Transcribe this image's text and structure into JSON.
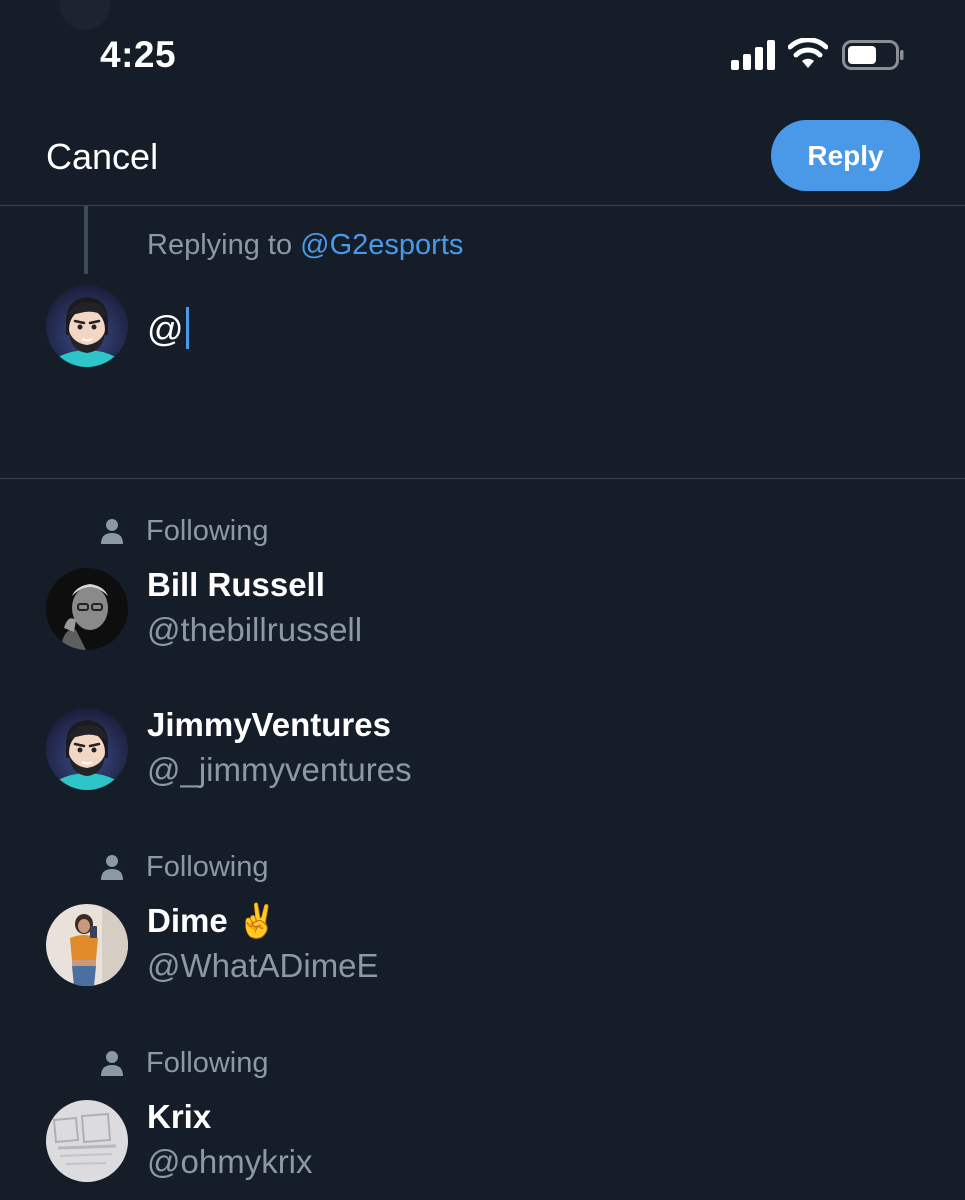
{
  "status_bar": {
    "time": "4:25",
    "icons": [
      "signal-icon",
      "wifi-icon",
      "battery-icon"
    ]
  },
  "nav": {
    "cancel_label": "Cancel",
    "reply_label": "Reply"
  },
  "compose": {
    "replying_prefix": "Replying to",
    "replying_handle": "@G2esports",
    "input_value": "@"
  },
  "suggestions": [
    {
      "following_label": "Following",
      "name": "Bill Russell",
      "handle": "@thebillrussell",
      "avatar": "bill-russell-photo"
    },
    {
      "following_label": "",
      "name": "JimmyVentures",
      "handle": "@_jimmyventures",
      "avatar": "cartoon-avatar"
    },
    {
      "following_label": "Following",
      "name": "Dime ✌️",
      "handle": "@WhatADimeE",
      "avatar": "dime-photo"
    },
    {
      "following_label": "Following",
      "name": "Krix",
      "handle": "@ohmykrix",
      "avatar": "krix-photo"
    }
  ],
  "colors": {
    "background": "#151d28",
    "accent": "#4a99e9",
    "secondary_text": "#8b98a5",
    "divider": "#3a4350"
  }
}
